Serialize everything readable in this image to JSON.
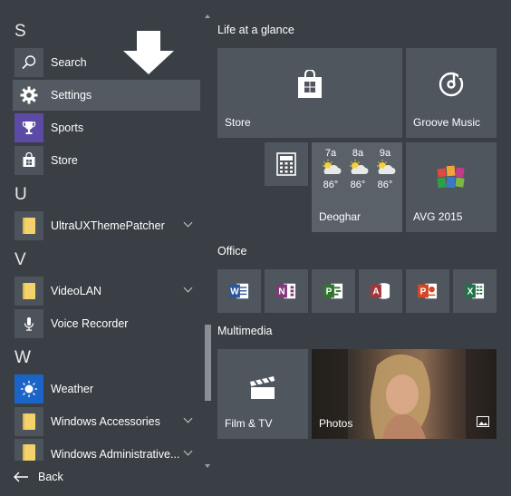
{
  "start_menu": {
    "sections": [
      {
        "letter": "S",
        "apps": [
          {
            "label": "Search",
            "icon": "search-icon"
          },
          {
            "label": "Settings",
            "icon": "gear-icon",
            "selected": true
          },
          {
            "label": "Sports",
            "icon": "trophy-icon"
          },
          {
            "label": "Store",
            "icon": "store-bag-icon"
          }
        ]
      },
      {
        "letter": "U",
        "apps": [
          {
            "label": "UltraUXThemePatcher",
            "icon": "folder-icon",
            "expandable": true
          }
        ]
      },
      {
        "letter": "V",
        "apps": [
          {
            "label": "VideoLAN",
            "icon": "folder-icon",
            "expandable": true
          },
          {
            "label": "Voice Recorder",
            "icon": "microphone-icon"
          }
        ]
      },
      {
        "letter": "W",
        "apps": [
          {
            "label": "Weather",
            "icon": "sun-icon"
          },
          {
            "label": "Windows Accessories",
            "icon": "folder-icon",
            "expandable": true
          },
          {
            "label": "Windows Administrative...",
            "icon": "folder-icon",
            "expandable": true
          }
        ]
      }
    ],
    "back_label": "Back"
  },
  "tile_groups": {
    "life": {
      "title": "Life at a glance",
      "store": "Store",
      "groove": "Groove Music",
      "weather": {
        "location": "Deoghar",
        "forecast": [
          {
            "time": "7a",
            "temp": "86°"
          },
          {
            "time": "8a",
            "temp": "86°"
          },
          {
            "time": "9a",
            "temp": "86°"
          }
        ]
      },
      "avg": "AVG 2015"
    },
    "office": {
      "title": "Office",
      "apps": [
        "Word",
        "OneNote",
        "Project",
        "Access",
        "PowerPoint",
        "Excel"
      ]
    },
    "multimedia": {
      "title": "Multimedia",
      "film": "Film & TV",
      "photos": "Photos"
    }
  },
  "colors": {
    "background": "#3a3f45",
    "tile": "#4f565e",
    "selected_row": "#545a61",
    "folder": "#f3d26b",
    "word": "#2b579a",
    "onenote": "#80397b",
    "project": "#31752f",
    "access": "#a4373a",
    "powerpoint": "#d24726",
    "excel": "#217346"
  }
}
